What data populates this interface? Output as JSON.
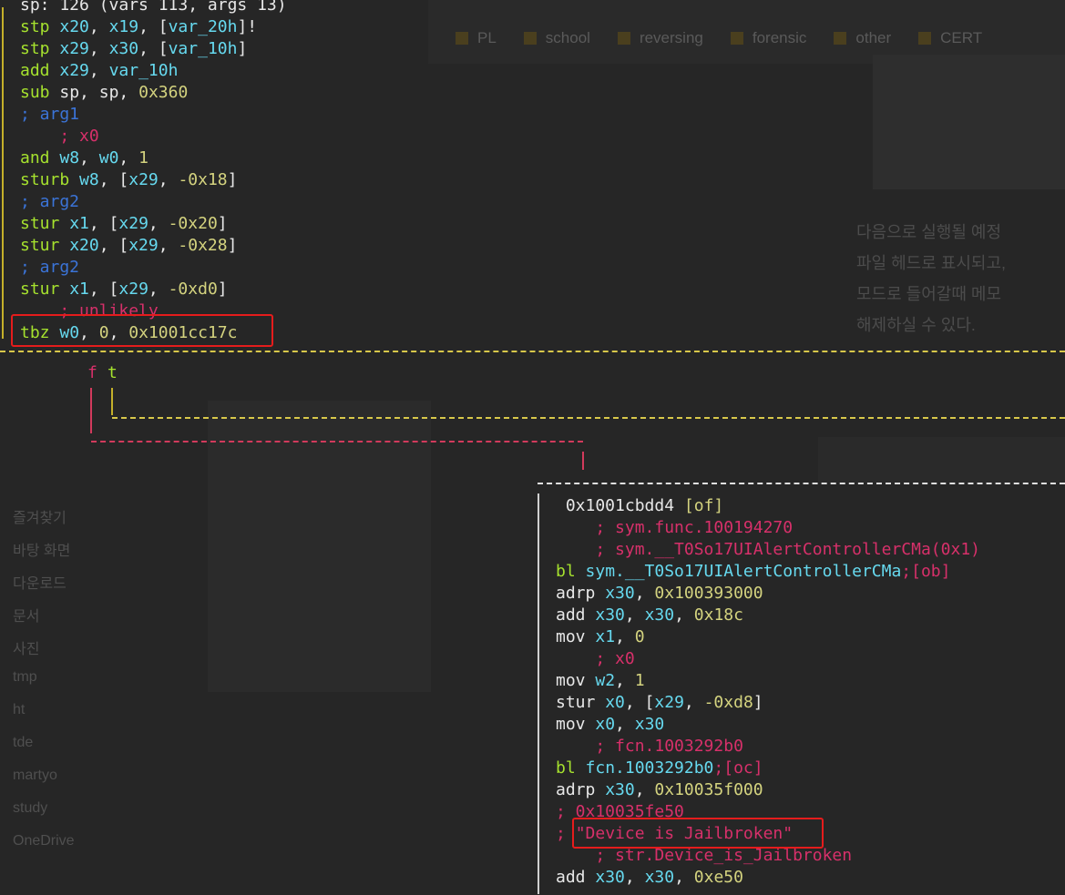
{
  "background": {
    "tabs": [
      "PL",
      "school",
      "reversing",
      "forensic",
      "other",
      "CERT"
    ],
    "sidebar": [
      "즐겨찾기",
      "바탕 화면",
      "다운로드",
      "문서",
      "사진",
      "tmp",
      "ht",
      "tde",
      "martyo",
      "study",
      "OneDrive"
    ],
    "korean_lines": [
      "다음으로 실행될 예정",
      "파일 헤드로 표시되고,",
      "모드로 들어갈때 메모",
      "해제하실 수 있다."
    ]
  },
  "node1": {
    "lines": [
      [
        {
          "t": "sp: 126 (vars 113, args 13)",
          "c": "dim"
        }
      ],
      [
        {
          "t": "stp ",
          "c": "kw"
        },
        {
          "t": "x20",
          "c": "reg"
        },
        {
          "t": ", ",
          "c": "dim"
        },
        {
          "t": "x19",
          "c": "reg"
        },
        {
          "t": ", [",
          "c": "dim"
        },
        {
          "t": "var_20h",
          "c": "var"
        },
        {
          "t": "]!",
          "c": "dim"
        }
      ],
      [
        {
          "t": "stp ",
          "c": "kw"
        },
        {
          "t": "x29",
          "c": "reg"
        },
        {
          "t": ", ",
          "c": "dim"
        },
        {
          "t": "x30",
          "c": "reg"
        },
        {
          "t": ", [",
          "c": "dim"
        },
        {
          "t": "var_10h",
          "c": "var"
        },
        {
          "t": "]",
          "c": "dim"
        }
      ],
      [
        {
          "t": "add ",
          "c": "kw"
        },
        {
          "t": "x29",
          "c": "reg"
        },
        {
          "t": ", ",
          "c": "dim"
        },
        {
          "t": "var_10h",
          "c": "var"
        }
      ],
      [
        {
          "t": "sub ",
          "c": "kw"
        },
        {
          "t": "sp",
          "c": "dim"
        },
        {
          "t": ", ",
          "c": "dim"
        },
        {
          "t": "sp",
          "c": "dim"
        },
        {
          "t": ", ",
          "c": "dim"
        },
        {
          "t": "0x360",
          "c": "num"
        }
      ],
      [
        {
          "t": "; arg1",
          "c": "cmt-blue"
        }
      ],
      [
        {
          "t": "    ; x0",
          "c": "cmt"
        }
      ],
      [
        {
          "t": "and ",
          "c": "kw"
        },
        {
          "t": "w8",
          "c": "reg"
        },
        {
          "t": ", ",
          "c": "dim"
        },
        {
          "t": "w0",
          "c": "reg"
        },
        {
          "t": ", ",
          "c": "dim"
        },
        {
          "t": "1",
          "c": "num"
        }
      ],
      [
        {
          "t": "sturb ",
          "c": "kw"
        },
        {
          "t": "w8",
          "c": "reg"
        },
        {
          "t": ", [",
          "c": "dim"
        },
        {
          "t": "x29",
          "c": "reg"
        },
        {
          "t": ", ",
          "c": "dim"
        },
        {
          "t": "-0x18",
          "c": "num"
        },
        {
          "t": "]",
          "c": "dim"
        }
      ],
      [
        {
          "t": "; arg2",
          "c": "cmt-blue"
        }
      ],
      [
        {
          "t": "stur ",
          "c": "kw"
        },
        {
          "t": "x1",
          "c": "reg"
        },
        {
          "t": ", [",
          "c": "dim"
        },
        {
          "t": "x29",
          "c": "reg"
        },
        {
          "t": ", ",
          "c": "dim"
        },
        {
          "t": "-0x20",
          "c": "num"
        },
        {
          "t": "]",
          "c": "dim"
        }
      ],
      [
        {
          "t": "stur ",
          "c": "kw"
        },
        {
          "t": "x20",
          "c": "reg"
        },
        {
          "t": ", [",
          "c": "dim"
        },
        {
          "t": "x29",
          "c": "reg"
        },
        {
          "t": ", ",
          "c": "dim"
        },
        {
          "t": "-0x28",
          "c": "num"
        },
        {
          "t": "]",
          "c": "dim"
        }
      ],
      [
        {
          "t": "; arg2",
          "c": "cmt-blue"
        }
      ],
      [
        {
          "t": "stur ",
          "c": "kw"
        },
        {
          "t": "x1",
          "c": "reg"
        },
        {
          "t": ", [",
          "c": "dim"
        },
        {
          "t": "x29",
          "c": "reg"
        },
        {
          "t": ", ",
          "c": "dim"
        },
        {
          "t": "-0xd0",
          "c": "num"
        },
        {
          "t": "]",
          "c": "dim"
        }
      ],
      [
        {
          "t": "    ; unlikely",
          "c": "cmt"
        }
      ],
      [
        {
          "t": "tbz ",
          "c": "kw"
        },
        {
          "t": "w0",
          "c": "reg"
        },
        {
          "t": ", ",
          "c": "dim"
        },
        {
          "t": "0",
          "c": "num"
        },
        {
          "t": ", ",
          "c": "dim"
        },
        {
          "t": "0x1001cc17c",
          "c": "num"
        }
      ]
    ]
  },
  "branch_labels": {
    "false": "f",
    "true": "t"
  },
  "node2": {
    "lines": [
      [
        {
          "t": " 0x1001cbdd4 ",
          "c": "dim"
        },
        {
          "t": "[of]",
          "c": "num"
        }
      ],
      [
        {
          "t": "    ; sym.func.100194270",
          "c": "cmt"
        }
      ],
      [
        {
          "t": "    ; sym.__T0So17UIAlertControllerCMa(0x1)",
          "c": "cmt"
        }
      ],
      [
        {
          "t": "bl ",
          "c": "kw"
        },
        {
          "t": "sym.__T0So17UIAlertControllerCMa",
          "c": "reg"
        },
        {
          "t": ";[ob]",
          "c": "cmt"
        }
      ],
      [
        {
          "t": "adrp ",
          "c": "dim"
        },
        {
          "t": "x30",
          "c": "reg"
        },
        {
          "t": ", ",
          "c": "dim"
        },
        {
          "t": "0x100393000",
          "c": "num"
        }
      ],
      [
        {
          "t": "add ",
          "c": "dim"
        },
        {
          "t": "x30",
          "c": "reg"
        },
        {
          "t": ", ",
          "c": "dim"
        },
        {
          "t": "x30",
          "c": "reg"
        },
        {
          "t": ", ",
          "c": "dim"
        },
        {
          "t": "0x18c",
          "c": "num"
        }
      ],
      [
        {
          "t": "mov ",
          "c": "dim"
        },
        {
          "t": "x1",
          "c": "reg"
        },
        {
          "t": ", ",
          "c": "dim"
        },
        {
          "t": "0",
          "c": "num"
        }
      ],
      [
        {
          "t": "    ; x0",
          "c": "cmt"
        }
      ],
      [
        {
          "t": "mov ",
          "c": "dim"
        },
        {
          "t": "w2",
          "c": "reg"
        },
        {
          "t": ", ",
          "c": "dim"
        },
        {
          "t": "1",
          "c": "num"
        }
      ],
      [
        {
          "t": "stur ",
          "c": "dim"
        },
        {
          "t": "x0",
          "c": "reg"
        },
        {
          "t": ", [",
          "c": "dim"
        },
        {
          "t": "x29",
          "c": "reg"
        },
        {
          "t": ", ",
          "c": "dim"
        },
        {
          "t": "-0xd8",
          "c": "num"
        },
        {
          "t": "]",
          "c": "dim"
        }
      ],
      [
        {
          "t": "mov ",
          "c": "dim"
        },
        {
          "t": "x0",
          "c": "reg"
        },
        {
          "t": ", ",
          "c": "dim"
        },
        {
          "t": "x30",
          "c": "reg"
        }
      ],
      [
        {
          "t": "    ; fcn.1003292b0",
          "c": "cmt"
        }
      ],
      [
        {
          "t": "bl ",
          "c": "kw"
        },
        {
          "t": "fcn.1003292b0",
          "c": "reg"
        },
        {
          "t": ";[oc]",
          "c": "cmt"
        }
      ],
      [
        {
          "t": "adrp ",
          "c": "dim"
        },
        {
          "t": "x30",
          "c": "reg"
        },
        {
          "t": ", ",
          "c": "dim"
        },
        {
          "t": "0x10035f000",
          "c": "num"
        }
      ],
      [
        {
          "t": "; 0x10035fe50",
          "c": "cmt"
        }
      ],
      [
        {
          "t": "; ",
          "c": "cmt"
        },
        {
          "t": "\"Device is Jailbroken\"",
          "c": "cmt"
        }
      ],
      [
        {
          "t": "    ; str.Device_is_Jailbroken",
          "c": "cmt"
        }
      ],
      [
        {
          "t": "add ",
          "c": "dim"
        },
        {
          "t": "x30",
          "c": "reg"
        },
        {
          "t": ", ",
          "c": "dim"
        },
        {
          "t": "x30",
          "c": "reg"
        },
        {
          "t": ", ",
          "c": "dim"
        },
        {
          "t": "0xe50",
          "c": "num"
        }
      ]
    ]
  }
}
